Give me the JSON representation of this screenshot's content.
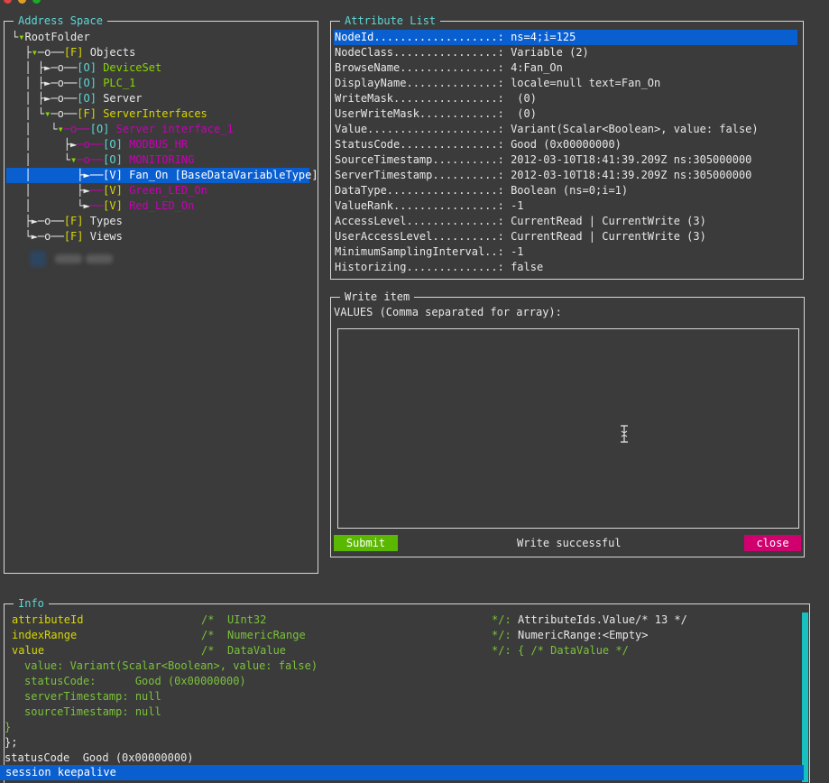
{
  "colors": {
    "background": "#3b3b3b",
    "selection": "#0a5fd0",
    "submit": "#5ab800",
    "close": "#d0006e",
    "scrollbar": "#19c0c0"
  },
  "address_space": {
    "title": "Address Space",
    "nodes": [
      {
        "prefix": "└",
        "marker": "▾",
        "label": "RootFolder"
      },
      {
        "prefix": "  ├",
        "marker": "▾",
        "link": "─o──",
        "tag": "[F]",
        "label": "Objects"
      },
      {
        "prefix": "  │ ├",
        "marker": "►",
        "link": "─o──",
        "tag": "[O]",
        "label": "DeviceSet"
      },
      {
        "prefix": "  │ ├",
        "marker": "►",
        "link": "─o──",
        "tag": "[O]",
        "label": "PLC_1"
      },
      {
        "prefix": "  │ ├",
        "marker": "►",
        "link": "─o──",
        "tag": "[O]",
        "label": "Server"
      },
      {
        "prefix": "  │ └",
        "marker": "▾",
        "link": "─o──",
        "tag": "[F]",
        "label": "ServerInterfaces"
      },
      {
        "prefix": "  │   └",
        "marker": "▾",
        "link": "─o──",
        "tag": "[O]",
        "label": "Server interface_1"
      },
      {
        "prefix": "  │     ├",
        "marker": "►",
        "link": "─o──",
        "tag": "[O]",
        "label": "MODBUS_HR"
      },
      {
        "prefix": "  │     └",
        "marker": "▾",
        "link": "─o──",
        "tag": "[O]",
        "label": "MONITORING"
      },
      {
        "prefix": "  │       ├",
        "marker": "►",
        "link": "──",
        "tag": "[V]",
        "label": "Fan_On [BaseDataVariableType]"
      },
      {
        "prefix": "  │       ├",
        "marker": "►",
        "link": "──",
        "tag": "[V]",
        "label": "Green_LED_On"
      },
      {
        "prefix": "  │       └",
        "marker": "►",
        "link": "──",
        "tag": "[V]",
        "label": "Red_LED_On"
      },
      {
        "prefix": "  ├",
        "marker": "►",
        "link": "─o──",
        "tag": "[F]",
        "label": "Types"
      },
      {
        "prefix": "  └",
        "marker": "►",
        "link": "─o──",
        "tag": "[F]",
        "label": "Views"
      }
    ]
  },
  "attribute_list": {
    "title": "Attribute List",
    "rows": [
      {
        "key": "NodeId",
        "value": "ns=4;i=125"
      },
      {
        "key": "NodeClass",
        "value": "Variable (2)"
      },
      {
        "key": "BrowseName",
        "value": "4:Fan_On"
      },
      {
        "key": "DisplayName",
        "value": "locale=null text=Fan_On"
      },
      {
        "key": "WriteMask",
        "value": " (0)"
      },
      {
        "key": "UserWriteMask",
        "value": " (0)"
      },
      {
        "key": "Value",
        "value": "Variant(Scalar<Boolean>, value: false)"
      },
      {
        "key": "StatusCode",
        "value": "Good (0x00000000)"
      },
      {
        "key": "SourceTimestamp",
        "value": "2012-03-10T18:41:39.209Z ns:305000000"
      },
      {
        "key": "ServerTimestamp",
        "value": "2012-03-10T18:41:39.209Z ns:305000000"
      },
      {
        "key": "DataType",
        "value": "Boolean (ns=0;i=1)"
      },
      {
        "key": "ValueRank",
        "value": "-1"
      },
      {
        "key": "AccessLevel",
        "value": "CurrentRead | CurrentWrite (3)"
      },
      {
        "key": "UserAccessLevel",
        "value": "CurrentRead | CurrentWrite (3)"
      },
      {
        "key": "MinimumSamplingInterval",
        "value": "-1"
      },
      {
        "key": "Historizing",
        "value": "false"
      }
    ]
  },
  "write_item": {
    "title": "Write item",
    "label": "VALUES (Comma separated for array):",
    "value": "",
    "submit": "Submit",
    "status": "Write successful",
    "close": "close"
  },
  "info": {
    "title": "Info",
    "fields": [
      {
        "name": "attributeId",
        "comment_open": "/*",
        "type": "UInt32",
        "comment_close": "*/:",
        "value": "AttributeIds.Value/* 13 */"
      },
      {
        "name": "indexRange",
        "comment_open": "/*",
        "type": "NumericRange",
        "comment_close": "*/:",
        "value": "NumericRange:<Empty>"
      },
      {
        "name": "value",
        "comment_open": "/*",
        "type": "DataValue",
        "comment_close": "*/:",
        "value": "{ /* DataValue */"
      }
    ],
    "data_value_lines": [
      "value: Variant(Scalar<Boolean>, value: false)",
      "statusCode:      Good (0x00000000)",
      "serverTimestamp: null",
      "sourceTimestamp: null"
    ],
    "close_brace": "}",
    "close_stmt": "};",
    "status_line": "statusCode  Good (0x00000000)",
    "keepalive": "session keepalive"
  }
}
